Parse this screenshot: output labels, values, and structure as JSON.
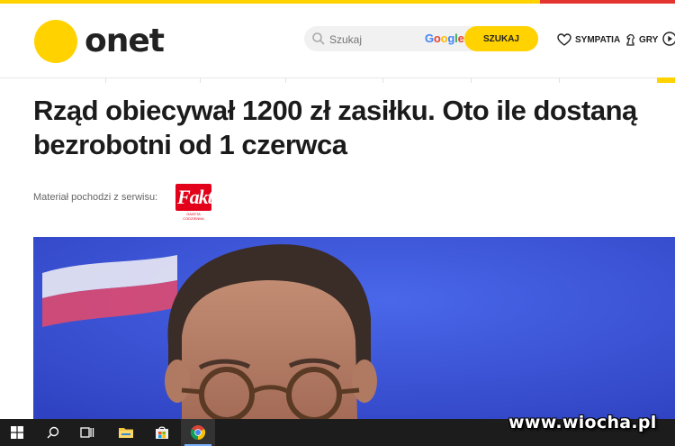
{
  "header": {
    "logo_text": "onet",
    "search": {
      "placeholder": "Szukaj",
      "provider": "Google",
      "button_label": "SZUKAJ"
    },
    "nav": {
      "sympatia": "SYMPATIA",
      "gry": "GRY"
    }
  },
  "article": {
    "title": "Rząd obiecywał 1200 zł zasiłku. Oto ile dostaną bezrobotni od 1 czerwca",
    "source_label": "Materiał pochodzi z serwisu:",
    "source_logo": "Fakt",
    "source_logo_sub": "GAZETA CODZIENNA"
  },
  "taskbar": {
    "items": [
      "windows-start",
      "search",
      "task-view",
      "file-explorer",
      "microsoft-store",
      "chrome"
    ]
  },
  "watermark": "www.wiocha.pl",
  "colors": {
    "brand_yellow": "#ffd200",
    "hero_blue": "#3b53d6",
    "fakt_red": "#e2001a",
    "taskbar": "#1c1c1c"
  }
}
